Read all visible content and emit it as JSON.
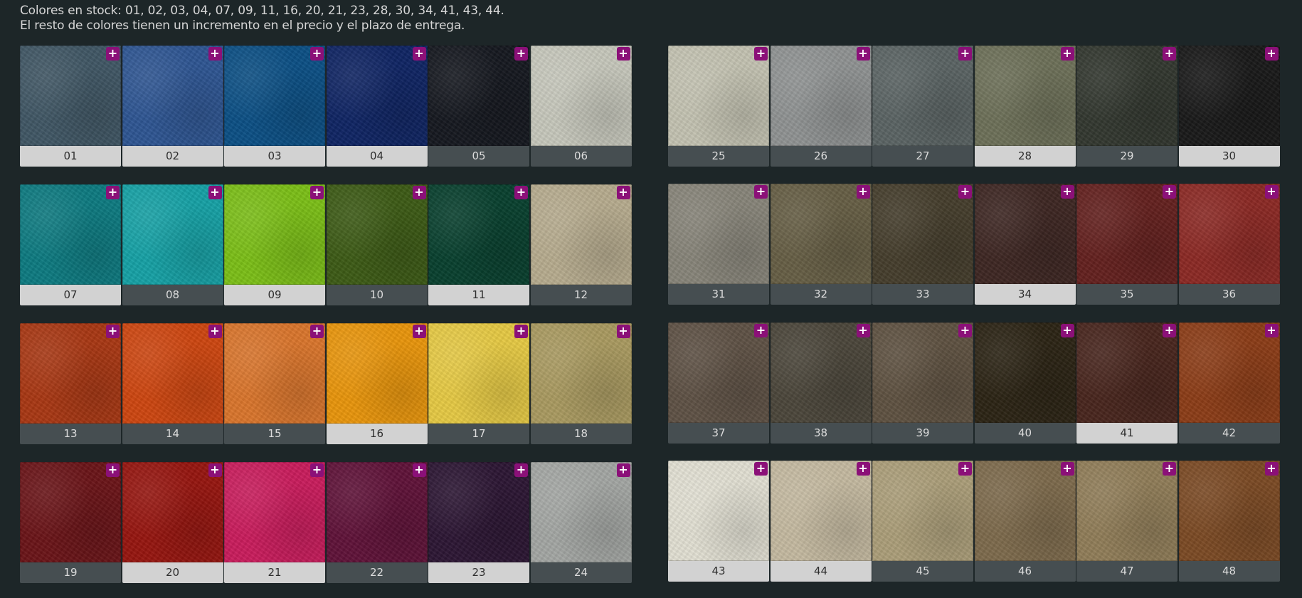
{
  "notice": {
    "line1": "Colores en stock: 01, 02, 03, 04, 07, 09, 11, 16, 20, 21, 23, 28, 30, 34, 41, 43, 44.",
    "line2": "El resto de colores tienen un incremento en el precio y el plazo de entrega."
  },
  "plus_symbol": "+",
  "colors": {
    "plus_badge": "#8b1078",
    "stock_label_bg": "#d2d2d2",
    "nostock_label_bg": "#464e51",
    "page_bg": "#1d2628"
  },
  "swatches": [
    {
      "code": "01",
      "color": "#405664",
      "in_stock": true
    },
    {
      "code": "02",
      "color": "#2e5592",
      "in_stock": true
    },
    {
      "code": "03",
      "color": "#0b4f84",
      "in_stock": true
    },
    {
      "code": "04",
      "color": "#0f2463",
      "in_stock": true
    },
    {
      "code": "05",
      "color": "#15181f",
      "in_stock": false
    },
    {
      "code": "06",
      "color": "#c6c7bb",
      "in_stock": false
    },
    {
      "code": "07",
      "color": "#0d7a80",
      "in_stock": true
    },
    {
      "code": "08",
      "color": "#16a1a5",
      "in_stock": false
    },
    {
      "code": "09",
      "color": "#7bbe17",
      "in_stock": true
    },
    {
      "code": "10",
      "color": "#3c5a15",
      "in_stock": false
    },
    {
      "code": "11",
      "color": "#08402e",
      "in_stock": true
    },
    {
      "code": "12",
      "color": "#b6ab8e",
      "in_stock": false
    },
    {
      "code": "13",
      "color": "#a83713",
      "in_stock": false
    },
    {
      "code": "14",
      "color": "#cd4610",
      "in_stock": false
    },
    {
      "code": "15",
      "color": "#d9752c",
      "in_stock": false
    },
    {
      "code": "16",
      "color": "#e8950b",
      "in_stock": true
    },
    {
      "code": "17",
      "color": "#e5c944",
      "in_stock": false
    },
    {
      "code": "18",
      "color": "#a99a60",
      "in_stock": false
    },
    {
      "code": "19",
      "color": "#6a1418",
      "in_stock": false
    },
    {
      "code": "20",
      "color": "#96150f",
      "in_stock": true
    },
    {
      "code": "21",
      "color": "#c91c5c",
      "in_stock": true
    },
    {
      "code": "22",
      "color": "#5f1238",
      "in_stock": false
    },
    {
      "code": "23",
      "color": "#2c1633",
      "in_stock": true
    },
    {
      "code": "24",
      "color": "#a3a6a3",
      "in_stock": false
    },
    {
      "code": "25",
      "color": "#c3c2b1",
      "in_stock": false
    },
    {
      "code": "26",
      "color": "#8f9292",
      "in_stock": false
    },
    {
      "code": "27",
      "color": "#5a6363",
      "in_stock": false
    },
    {
      "code": "28",
      "color": "#6d7058",
      "in_stock": true
    },
    {
      "code": "29",
      "color": "#32372f",
      "in_stock": false
    },
    {
      "code": "30",
      "color": "#191919",
      "in_stock": true
    },
    {
      "code": "31",
      "color": "#878479",
      "in_stock": false
    },
    {
      "code": "32",
      "color": "#665e45",
      "in_stock": false
    },
    {
      "code": "33",
      "color": "#453d2c",
      "in_stock": false
    },
    {
      "code": "34",
      "color": "#3d2622",
      "in_stock": true
    },
    {
      "code": "35",
      "color": "#63201e",
      "in_stock": false
    },
    {
      "code": "36",
      "color": "#8b2924",
      "in_stock": false
    },
    {
      "code": "37",
      "color": "#5e5145",
      "in_stock": false
    },
    {
      "code": "38",
      "color": "#4b463a",
      "in_stock": false
    },
    {
      "code": "39",
      "color": "#5e5141",
      "in_stock": false
    },
    {
      "code": "40",
      "color": "#2b2314",
      "in_stock": false
    },
    {
      "code": "41",
      "color": "#48251d",
      "in_stock": true
    },
    {
      "code": "42",
      "color": "#8b3c17",
      "in_stock": false
    },
    {
      "code": "43",
      "color": "#e1dfd2",
      "in_stock": true
    },
    {
      "code": "44",
      "color": "#c4b9a0",
      "in_stock": true
    },
    {
      "code": "45",
      "color": "#ab9e79",
      "in_stock": false
    },
    {
      "code": "46",
      "color": "#7d6a4c",
      "in_stock": false
    },
    {
      "code": "47",
      "color": "#907d58",
      "in_stock": false
    },
    {
      "code": "48",
      "color": "#7b4a24",
      "in_stock": false
    }
  ]
}
